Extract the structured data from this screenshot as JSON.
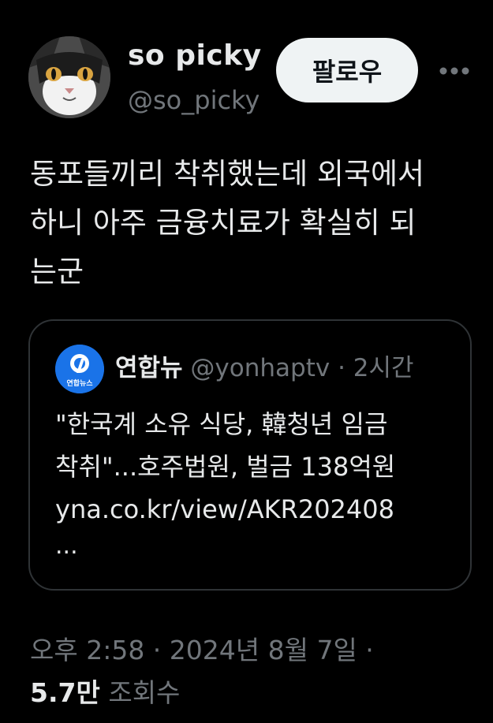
{
  "author": {
    "display_name": "so picky",
    "handle": "@so_picky",
    "avatar_icon": "cat-avatar-icon"
  },
  "follow_button": {
    "label": "팔로우"
  },
  "more_icon": "more-horizontal-icon",
  "tweet": {
    "text": "동포들끼리 착취했는데 외국에서\n하니 아주 금융치료가 확실히 되\n는군"
  },
  "quote": {
    "avatar_icon": "yonhap-logo-icon",
    "avatar_text": "연합뉴스",
    "name": "연합뉴",
    "handle": "@yonhaptv",
    "dot": "·",
    "time": "2시간",
    "text": "\"한국계 소유 식당, 韓청년 임금\n착취\"...호주법원, 벌금 138억원\nyna.co.kr/view/AKR202408",
    "ellipsis": "..."
  },
  "meta": {
    "timestamp": "오후 2:58 · 2024년 8월 7일 ·"
  },
  "views": {
    "count": "5.7만",
    "label": "조회수"
  },
  "colors": {
    "background": "#000000",
    "text_primary": "#e7e9ea",
    "text_secondary": "#71767b",
    "border": "#2f3336",
    "follow_bg": "#eff3f4",
    "yonhap_blue": "#1a73e8"
  }
}
